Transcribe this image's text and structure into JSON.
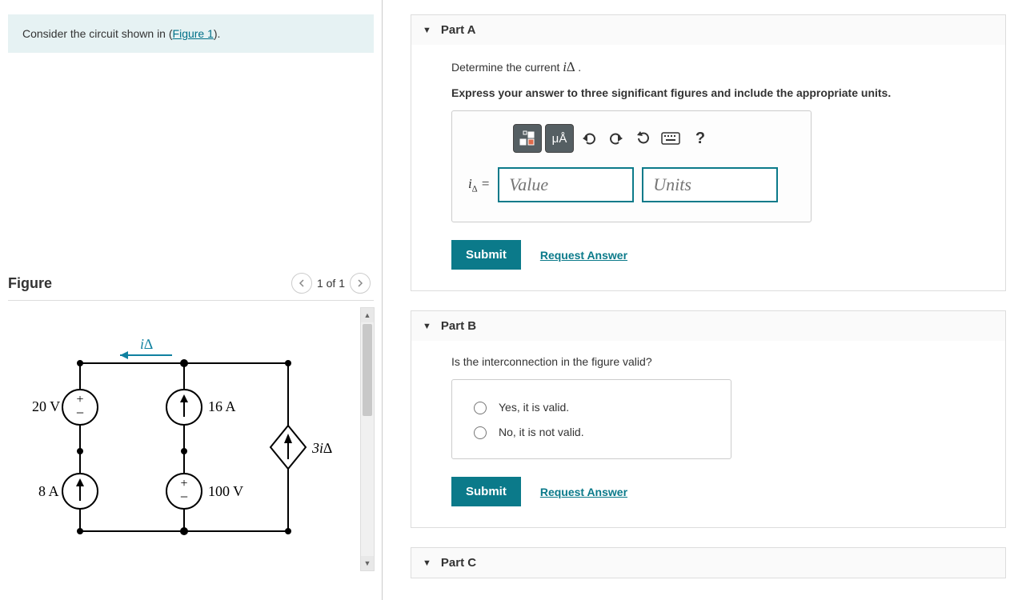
{
  "prompt": {
    "prefix": "Consider the circuit shown in (",
    "link": "Figure 1",
    "suffix": ")."
  },
  "figure": {
    "title": "Figure",
    "counter": "1 of 1",
    "labels": {
      "i_delta": "i∆",
      "v20": "20 V",
      "a8": "8 A",
      "a16": "16 A",
      "v100": "100 V",
      "dep": "3i∆"
    }
  },
  "partA": {
    "title": "Part A",
    "line1_pre": "Determine the current ",
    "line1_var": "i∆",
    "line1_post": " .",
    "line2": "Express your answer to three significant figures and include the appropriate units.",
    "toolbar": {
      "units_btn": "μÅ",
      "help": "?"
    },
    "var_label": "i∆ =",
    "value_ph": "Value",
    "units_ph": "Units",
    "submit": "Submit",
    "request": "Request Answer"
  },
  "partB": {
    "title": "Part B",
    "question": "Is the interconnection in the figure valid?",
    "opt_yes": "Yes, it is valid.",
    "opt_no": "No, it is not valid.",
    "submit": "Submit",
    "request": "Request Answer"
  },
  "partC": {
    "title": "Part C"
  }
}
